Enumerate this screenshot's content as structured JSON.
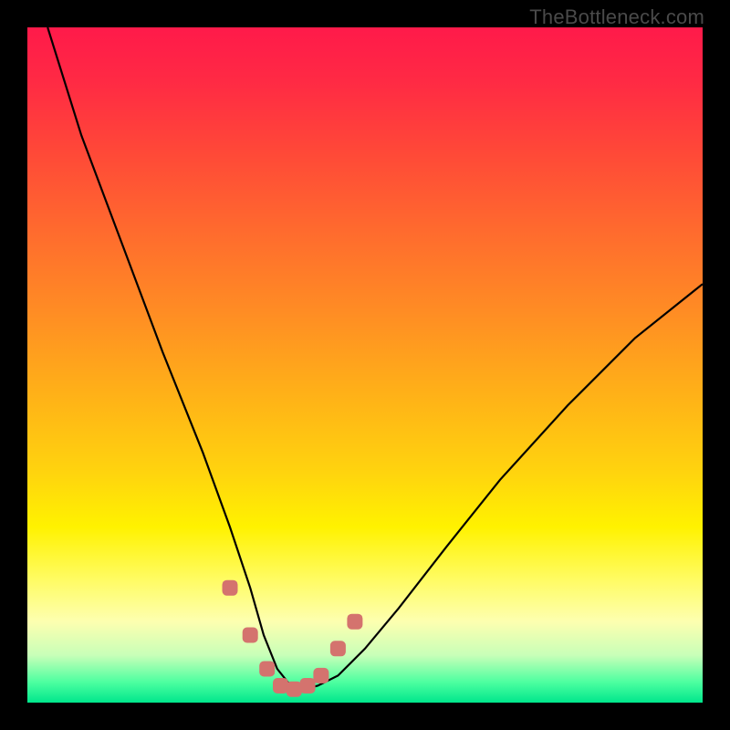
{
  "watermark": "TheBottleneck.com",
  "chart_data": {
    "type": "line",
    "title": "",
    "xlabel": "",
    "ylabel": "",
    "xlim": [
      0,
      100
    ],
    "ylim": [
      0,
      100
    ],
    "series": [
      {
        "name": "curve",
        "x": [
          3,
          8,
          14,
          20,
          26,
          30,
          33,
          35,
          37,
          39,
          41,
          43,
          46,
          50,
          55,
          62,
          70,
          80,
          90,
          100
        ],
        "values": [
          100,
          84,
          68,
          52,
          37,
          26,
          17,
          10,
          5,
          2.5,
          2,
          2.5,
          4,
          8,
          14,
          23,
          33,
          44,
          54,
          62
        ]
      }
    ],
    "markers": {
      "name": "sweet-spot",
      "x": [
        30,
        33,
        35.5,
        37.5,
        39.5,
        41.5,
        43.5,
        46,
        48.5
      ],
      "values": [
        17,
        10,
        5,
        2.5,
        2,
        2.5,
        4,
        8,
        12
      ],
      "color": "#d4736e",
      "shape": "rounded-square"
    },
    "background_gradient": {
      "stops": [
        {
          "pos": 0,
          "color": "#ff1a4a"
        },
        {
          "pos": 18,
          "color": "#ff4738"
        },
        {
          "pos": 42,
          "color": "#ff8c24"
        },
        {
          "pos": 66,
          "color": "#ffd40e"
        },
        {
          "pos": 82,
          "color": "#fffc66"
        },
        {
          "pos": 93,
          "color": "#c8ffb8"
        },
        {
          "pos": 100,
          "color": "#00e68c"
        }
      ]
    }
  }
}
